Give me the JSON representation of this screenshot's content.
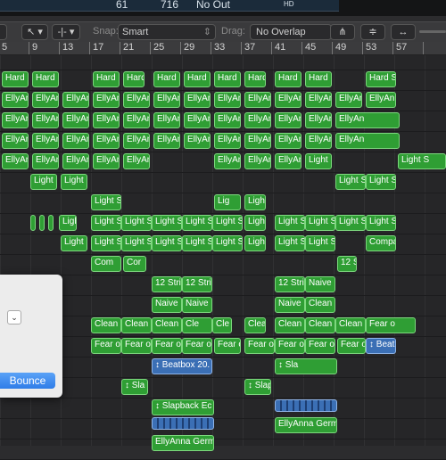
{
  "lcd": {
    "v1": "61",
    "v2": "716",
    "status": "No Out",
    "badge": "HD"
  },
  "toolbar": {
    "pointer_tool": "↖ ▾",
    "marquee_tool": "-|- ▾",
    "snap_label": "Snap:",
    "snap_value": "Smart",
    "drag_label": "Drag:",
    "drag_value": "No Overlap"
  },
  "ruler": [
    "5",
    "9",
    "13",
    "17",
    "21",
    "25",
    "29",
    "33",
    "37",
    "41",
    "45",
    "49",
    "53",
    "57"
  ],
  "regions": [
    {
      "label": "Hard S",
      "color": "g"
    },
    {
      "label": "Hard S",
      "color": "g"
    },
    {
      "label": "Hard S",
      "color": "g"
    },
    {
      "label": "Hard",
      "color": "g"
    },
    {
      "label": "Hard S",
      "color": "g"
    },
    {
      "label": "Hard S",
      "color": "g"
    },
    {
      "label": "Hard S",
      "color": "g"
    },
    {
      "label": "Hard",
      "color": "g"
    },
    {
      "label": "Hard S",
      "color": "g"
    },
    {
      "label": "Hard S",
      "color": "g"
    },
    {
      "label": "Hard S",
      "color": "g"
    },
    {
      "label": "EllyAn",
      "color": "g"
    },
    {
      "label": "EllyAn",
      "color": "g"
    },
    {
      "label": "EllyAn",
      "color": "g"
    },
    {
      "label": "EllyAn",
      "color": "g"
    },
    {
      "label": "EllyAn",
      "color": "g"
    },
    {
      "label": "EllyAn",
      "color": "g"
    },
    {
      "label": "EllyAn",
      "color": "g"
    },
    {
      "label": "EllyAn",
      "color": "g"
    },
    {
      "label": "EllyAn",
      "color": "g"
    },
    {
      "label": "EllyAn",
      "color": "g"
    },
    {
      "label": "EllyAn",
      "color": "g"
    },
    {
      "label": "EllyAn",
      "color": "g"
    },
    {
      "label": "EllyAn",
      "color": "g"
    },
    {
      "label": "EllyAn",
      "color": "g"
    },
    {
      "label": "EllyAn",
      "color": "g"
    },
    {
      "label": "EllyAn",
      "color": "g"
    },
    {
      "label": "EllyAn",
      "color": "g"
    },
    {
      "label": "EllyAn",
      "color": "g"
    },
    {
      "label": "EllyAn",
      "color": "g"
    },
    {
      "label": "EllyAn",
      "color": "g"
    },
    {
      "label": "EllyAn",
      "color": "g"
    },
    {
      "label": "EllyAn",
      "color": "g"
    },
    {
      "label": "EllyAn",
      "color": "g"
    },
    {
      "label": "EllyAnna Germ",
      "color": "g"
    },
    {
      "label": "EllyAn",
      "color": "g"
    },
    {
      "label": "EllyAn",
      "color": "g"
    },
    {
      "label": "EllyAn",
      "color": "g"
    },
    {
      "label": "EllyAn",
      "color": "g"
    },
    {
      "label": "EllyAn",
      "color": "g"
    },
    {
      "label": "EllyAn",
      "color": "g"
    },
    {
      "label": "EllyAn",
      "color": "g"
    },
    {
      "label": "EllyAn",
      "color": "g"
    },
    {
      "label": "EllyAn",
      "color": "g"
    },
    {
      "label": "EllyAn",
      "color": "g"
    },
    {
      "label": "EllyAnna Germ",
      "color": "g"
    },
    {
      "label": "EllyAn",
      "color": "g"
    },
    {
      "label": "EllyAn",
      "color": "g"
    },
    {
      "label": "EllyAn",
      "color": "g"
    },
    {
      "label": "EllyAn",
      "color": "g"
    },
    {
      "label": "EllyAn",
      "color": "g"
    },
    {
      "label": "EllyAn",
      "color": "g"
    },
    {
      "label": "EllyAn",
      "color": "g"
    },
    {
      "label": "EllyAn",
      "color": "g"
    },
    {
      "label": "EllyAn",
      "color": "g"
    },
    {
      "label": "EllyAn",
      "color": "g"
    },
    {
      "label": "Light S",
      "color": "g"
    },
    {
      "label": "Light S",
      "color": "g"
    },
    {
      "label": "Light S",
      "color": "g"
    },
    {
      "label": "Light S",
      "color": "g"
    },
    {
      "label": "Light S",
      "color": "g"
    },
    {
      "label": "Light S",
      "color": "g"
    },
    {
      "label": "Light S",
      "color": "g"
    },
    {
      "label": "Lig",
      "color": "g"
    },
    {
      "label": "Light S",
      "color": "g"
    },
    {
      "label": "Light S",
      "color": "g"
    },
    {
      "label": "Light S",
      "color": "g"
    },
    {
      "label": "Light S",
      "color": "g"
    },
    {
      "label": "Light S",
      "color": "g"
    },
    {
      "label": "Light S",
      "color": "g"
    },
    {
      "label": "Light S",
      "color": "g"
    },
    {
      "label": "Light S",
      "color": "g"
    },
    {
      "label": "Light S",
      "color": "g"
    },
    {
      "label": "Light S",
      "color": "g"
    },
    {
      "label": "Light S",
      "color": "g"
    },
    {
      "label": "Light S",
      "color": "g"
    },
    {
      "label": "Light S",
      "color": "g"
    },
    {
      "label": "Light S",
      "color": "g"
    },
    {
      "label": "Light S",
      "color": "g"
    },
    {
      "label": "Light S",
      "color": "g"
    },
    {
      "label": "Light S",
      "color": "g"
    },
    {
      "label": "Light S",
      "color": "g"
    },
    {
      "label": "Light S",
      "color": "g"
    },
    {
      "label": "Light S",
      "color": "g"
    },
    {
      "label": "Light S",
      "color": "g"
    },
    {
      "label": "Compa",
      "color": "g"
    },
    {
      "label": "Com",
      "color": "g"
    },
    {
      "label": "Cor",
      "color": "g"
    },
    {
      "label": "12 Stri",
      "color": "g"
    },
    {
      "label": "12 Stri",
      "color": "g"
    },
    {
      "label": "12 Stri",
      "color": "g"
    },
    {
      "label": "12 Stri",
      "color": "g"
    },
    {
      "label": "Naive",
      "color": "g"
    },
    {
      "label": "Naive",
      "color": "g"
    },
    {
      "label": "Naive",
      "color": "g"
    },
    {
      "label": "Naive",
      "color": "g"
    },
    {
      "label": "Clean",
      "color": "g"
    },
    {
      "label": "Clean",
      "color": "g"
    },
    {
      "label": "Clean",
      "color": "g"
    },
    {
      "label": "Clean",
      "color": "g"
    },
    {
      "label": "Cle",
      "color": "g"
    },
    {
      "label": "Cle",
      "color": "g"
    },
    {
      "label": "Clean",
      "color": "g"
    },
    {
      "label": "Clean",
      "color": "g"
    },
    {
      "label": "Clean",
      "color": "g"
    },
    {
      "label": "Clean Cool",
      "color": "g"
    },
    {
      "label": "Fear o",
      "color": "g"
    },
    {
      "label": "Fear o",
      "color": "g"
    },
    {
      "label": "Fear o",
      "color": "g"
    },
    {
      "label": "Fear o",
      "color": "g"
    },
    {
      "label": "Fear o",
      "color": "g"
    },
    {
      "label": "Fear o",
      "color": "g"
    },
    {
      "label": "Fear o",
      "color": "g"
    },
    {
      "label": "Fear o",
      "color": "g"
    },
    {
      "label": "Fear o",
      "color": "g"
    },
    {
      "label": "Fear o",
      "color": "g"
    },
    {
      "label": "↕ Beatbox 20",
      "color": "b"
    },
    {
      "label": "↕ Beatbox 20.",
      "color": "b"
    },
    {
      "label": "↕ Sla",
      "color": "g"
    },
    {
      "label": "↕ Sla",
      "color": "g"
    },
    {
      "label": "↕ Slapback Ec",
      "color": "g"
    },
    {
      "label": "↕ Slapback Ec",
      "color": "g"
    },
    {
      "label": "",
      "color": "b"
    },
    {
      "label": "",
      "color": "b"
    },
    {
      "label": "EllyAnna Germ",
      "color": "g"
    },
    {
      "label": "EllyAnna Germ",
      "color": "g"
    }
  ],
  "dialog": {
    "popup_glyph": "⌄",
    "bounce_label": "Bounce"
  }
}
